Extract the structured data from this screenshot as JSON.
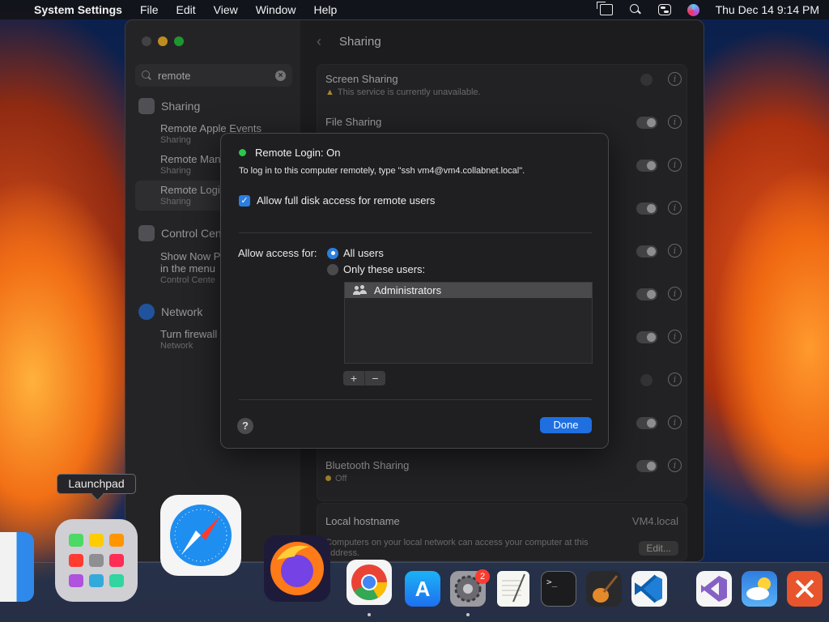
{
  "menubar": {
    "app_name": "System Settings",
    "menus": [
      "File",
      "Edit",
      "View",
      "Window",
      "Help"
    ],
    "clock": "Thu Dec 14  9:14 PM"
  },
  "sidebar": {
    "search_value": "remote",
    "sections": [
      {
        "label": "Sharing",
        "items": [
          {
            "title": "Remote Apple Events",
            "sub": "Sharing"
          },
          {
            "title": "Remote Man",
            "sub": "Sharing"
          },
          {
            "title": "Remote Logi",
            "sub": "Sharing"
          }
        ]
      },
      {
        "label": "Control Cen",
        "items": [
          {
            "title": "Show Now P",
            "title2": "in the menu",
            "sub": "Control Cente"
          }
        ]
      },
      {
        "label": "Network",
        "items": [
          {
            "title": "Turn firewall",
            "sub": "Network"
          }
        ]
      }
    ]
  },
  "content": {
    "title": "Sharing",
    "rows": [
      {
        "title": "Screen Sharing",
        "sub": "This service is currently unavailable."
      },
      {
        "title": "File Sharing",
        "sub": ""
      },
      {
        "title": "",
        "sub": ""
      },
      {
        "title": "",
        "sub": ""
      },
      {
        "title": "",
        "sub": ""
      },
      {
        "title": "",
        "sub": ""
      },
      {
        "title": "",
        "sub": ""
      },
      {
        "title": "",
        "sub": ""
      },
      {
        "title": "",
        "sub": ""
      },
      {
        "title": "Bluetooth Sharing",
        "sub": "Off"
      }
    ],
    "hostname_label": "Local hostname",
    "hostname_value": "VM4.local",
    "hostname_desc": "Computers on your local network can access your computer at this address.",
    "edit_label": "Edit..."
  },
  "sheet": {
    "status": "Remote Login: On",
    "instructions": "To log in to this computer remotely, type \"ssh vm4@vm4.collabnet.local\".",
    "checkbox_label": "Allow full disk access for remote users",
    "checkbox_checked": true,
    "access_label": "Allow access for:",
    "radio_all": "All users",
    "radio_only": "Only these users:",
    "users": [
      "Administrators"
    ],
    "add_label": "+",
    "remove_label": "−",
    "help_label": "?",
    "done_label": "Done",
    "colors": {
      "accent": "#1f6fe0",
      "status_green": "#2bc84a"
    }
  },
  "dock": {
    "tooltip": "Launchpad",
    "settings_badge": "2",
    "apps": [
      "finder-icon",
      "launchpad-icon",
      "safari-icon",
      "firefox-icon",
      "chrome-icon",
      "app-store-icon",
      "system-settings-icon",
      "textedit-icon",
      "terminal-icon",
      "garageband-icon",
      "vscode-icon",
      "visual-studio-icon",
      "weather-icon",
      "remote-desktop-icon"
    ]
  }
}
